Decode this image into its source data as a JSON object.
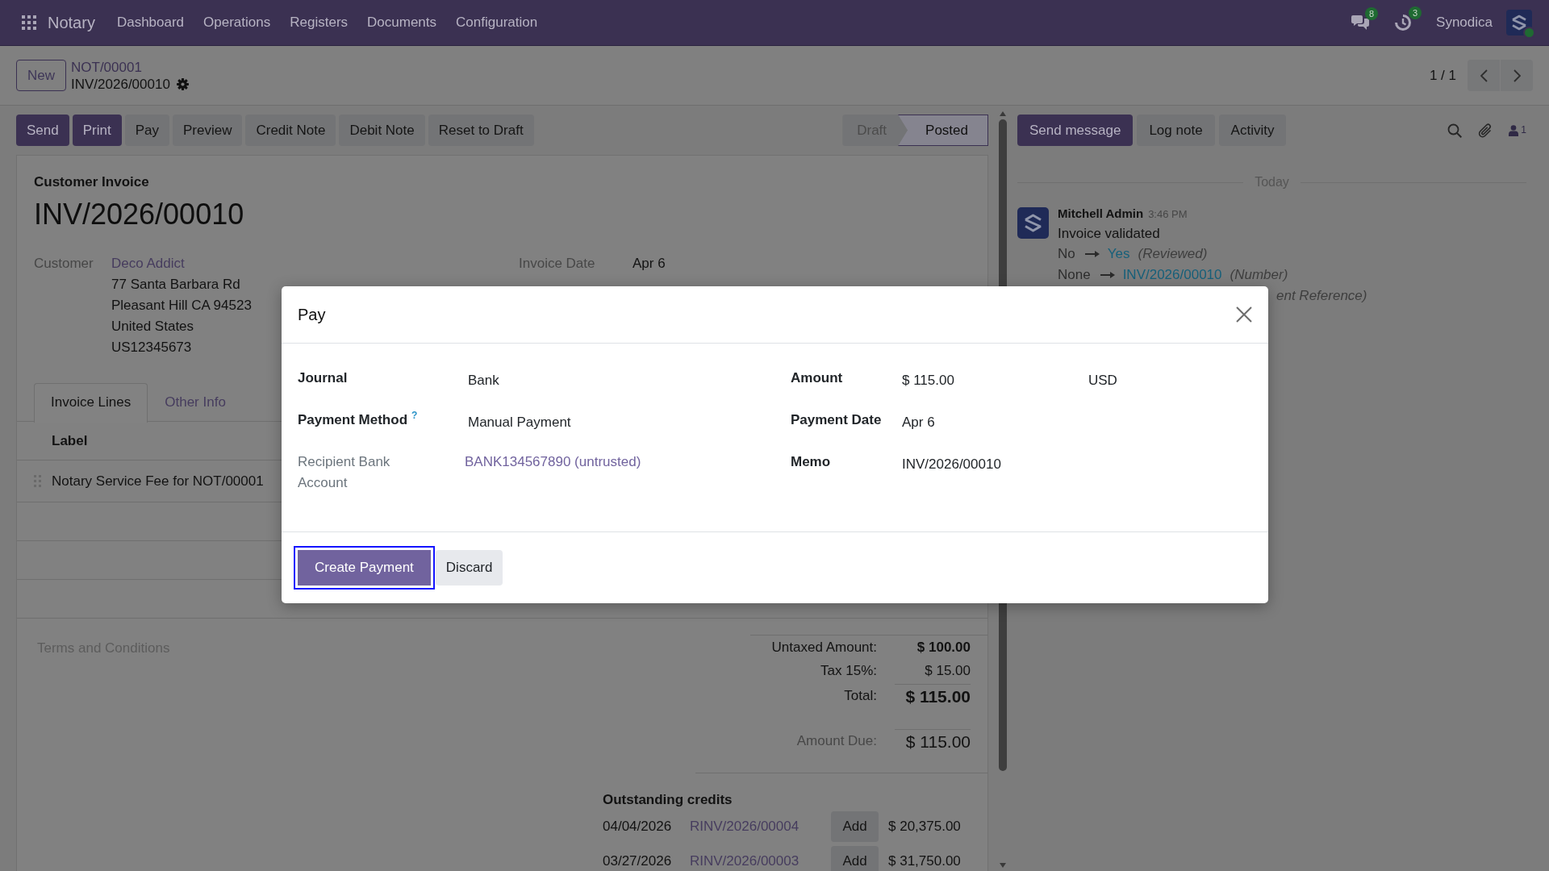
{
  "navbar": {
    "app": "Notary",
    "menu": [
      "Dashboard",
      "Operations",
      "Registers",
      "Documents",
      "Configuration"
    ],
    "messages_badge": "8",
    "activities_badge": "3",
    "company": "Synodica",
    "user_online": true
  },
  "control_panel": {
    "new_button": "New",
    "breadcrumb": "NOT/00001",
    "record": "INV/2026/00010",
    "pager": "1 / 1"
  },
  "action_buttons": [
    {
      "label": "Send",
      "kind": "primary"
    },
    {
      "label": "Print",
      "kind": "primary"
    },
    {
      "label": "Pay",
      "kind": "secondary"
    },
    {
      "label": "Preview",
      "kind": "secondary"
    },
    {
      "label": "Credit Note",
      "kind": "secondary"
    },
    {
      "label": "Debit Note",
      "kind": "secondary"
    },
    {
      "label": "Reset to Draft",
      "kind": "secondary"
    }
  ],
  "statusbar": [
    {
      "label": "Draft",
      "selected": false
    },
    {
      "label": "Posted",
      "selected": true
    }
  ],
  "form": {
    "type_label": "Customer Invoice",
    "name": "INV/2026/00010",
    "customer": {
      "label": "Customer",
      "name": "Deco Addict",
      "address": [
        "77 Santa Barbara Rd",
        "Pleasant Hill CA 94523",
        "United States",
        "US12345673"
      ]
    },
    "invoice_date": {
      "label": "Invoice Date",
      "value": "Apr 6"
    },
    "tabs": [
      {
        "label": "Invoice Lines",
        "selected": true
      },
      {
        "label": "Other Info",
        "selected": false
      }
    ],
    "lines": {
      "columns": [
        "Label"
      ],
      "rows": [
        [
          "Notary Service Fee for NOT/00001"
        ]
      ]
    },
    "terms": {
      "placeholder": "Terms and Conditions"
    },
    "totals": [
      {
        "label": "Untaxed Amount:",
        "value": "$ 100.00",
        "kind": "subtotal"
      },
      {
        "label": "Tax 15%:",
        "value": "$ 15.00",
        "kind": "tax"
      },
      {
        "label": "Total:",
        "value": "$ 115.00",
        "kind": "total"
      },
      {
        "label": "Amount Due:",
        "value": "$ 115.00",
        "kind": "due"
      }
    ],
    "outstanding_credits": {
      "title": "Outstanding credits",
      "rows": [
        {
          "date": "04/04/2026",
          "reference": "RINV/2026/00004",
          "button": "Add",
          "amount": "$ 20,375.00"
        },
        {
          "date": "03/27/2026",
          "reference": "RINV/2026/00003",
          "button": "Add",
          "amount": "$ 31,750.00"
        }
      ]
    }
  },
  "chatter": {
    "buttons": [
      {
        "label": "Send message",
        "kind": "primary"
      },
      {
        "label": "Log note",
        "kind": "secondary"
      },
      {
        "label": "Activity",
        "kind": "secondary"
      }
    ],
    "followers_count": "1",
    "date_separator": "Today",
    "message": {
      "author": "Mitchell Admin",
      "time": "3:46 PM",
      "body": "Invoice validated",
      "changes": [
        {
          "old": "No",
          "new": "Yes",
          "field": "(Reviewed)"
        },
        {
          "old": "None",
          "new": "INV/2026/00010",
          "field": "(Number)"
        }
      ],
      "partial_line": "ent Reference)"
    }
  },
  "dialog": {
    "title": "Pay",
    "left_fields": [
      {
        "label": "Journal",
        "value": "Bank",
        "kind": "input",
        "readonly": false
      },
      {
        "label": "Payment Method",
        "help": "?",
        "value": "Manual Payment",
        "kind": "input",
        "readonly": false
      },
      {
        "label": "Recipient Bank Account",
        "value": "BANK134567890 (untrusted)",
        "kind": "link",
        "readonly": true
      }
    ],
    "right_fields": [
      {
        "label": "Amount",
        "value": "$ 115.00",
        "currency": "USD",
        "kind": "input",
        "readonly": false
      },
      {
        "label": "Payment Date",
        "value": "Apr 6",
        "kind": "input",
        "readonly": false
      },
      {
        "label": "Memo",
        "value": "INV/2026/00010",
        "kind": "input",
        "readonly": false
      }
    ],
    "buttons": [
      {
        "label": "Create Payment",
        "kind": "primary",
        "focused": true
      },
      {
        "label": "Discard",
        "kind": "secondary",
        "focused": false
      }
    ]
  }
}
